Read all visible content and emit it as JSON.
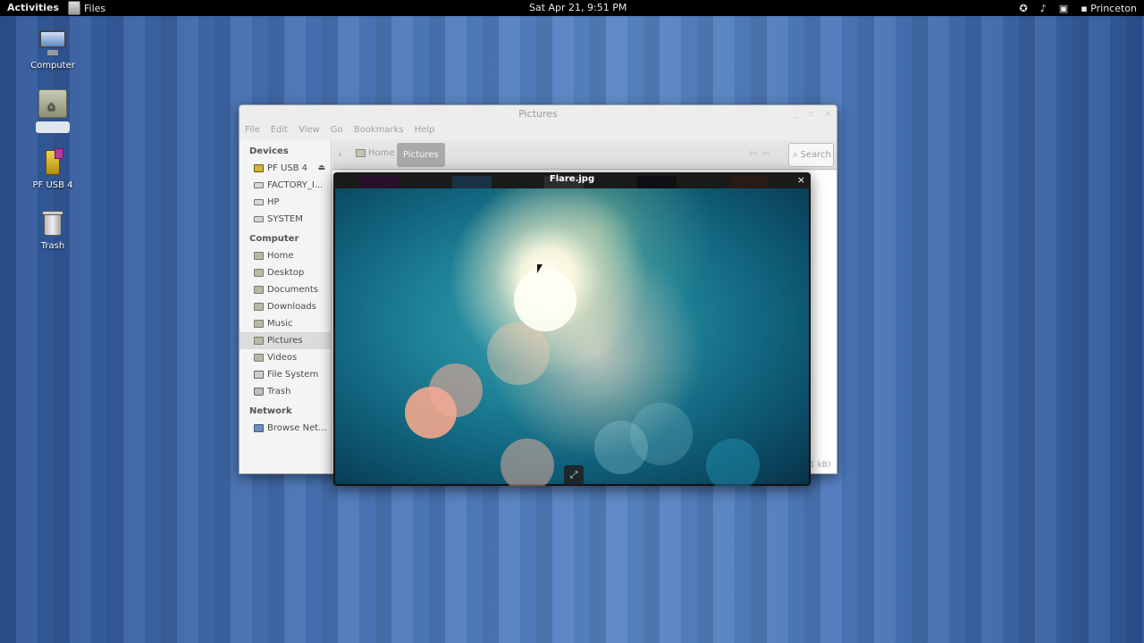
{
  "topbar": {
    "activities": "Activities",
    "app_name": "Files",
    "clock": "Sat Apr 21,  9:51 PM",
    "user": "Princeton",
    "icons": [
      "accessibility-icon",
      "volume-icon",
      "network-icon",
      "chat-icon"
    ]
  },
  "desktop": {
    "icons": [
      {
        "label": "Computer"
      },
      {
        "label": "Home"
      },
      {
        "label": "PF USB 4"
      },
      {
        "label": "Trash"
      }
    ]
  },
  "window": {
    "title": "Pictures",
    "menus": [
      "File",
      "Edit",
      "View",
      "Go",
      "Bookmarks",
      "Help"
    ],
    "sidebar": {
      "devices_heading": "Devices",
      "devices": [
        {
          "label": "PF USB 4"
        },
        {
          "label": "FACTORY_I..."
        },
        {
          "label": "HP"
        },
        {
          "label": "SYSTEM"
        }
      ],
      "computer_heading": "Computer",
      "computer": [
        {
          "label": "Home"
        },
        {
          "label": "Desktop"
        },
        {
          "label": "Documents"
        },
        {
          "label": "Downloads"
        },
        {
          "label": "Music"
        },
        {
          "label": "Pictures"
        },
        {
          "label": "Videos"
        },
        {
          "label": "File System"
        },
        {
          "label": "Trash"
        }
      ],
      "network_heading": "Network",
      "network": [
        {
          "label": "Browse Net..."
        }
      ],
      "selected": "Pictures"
    },
    "toolbar": {
      "breadcrumb_home": "Home",
      "breadcrumb_current": "Pictures",
      "search_label": "Search"
    },
    "status_fragment": "1 kB)"
  },
  "preview": {
    "title": "Flare.jpg",
    "close_label": "×",
    "fullscreen_label": "⤢"
  },
  "colors": {
    "accent_wallpaper": "#3d67a8",
    "topbar": "#000000"
  }
}
